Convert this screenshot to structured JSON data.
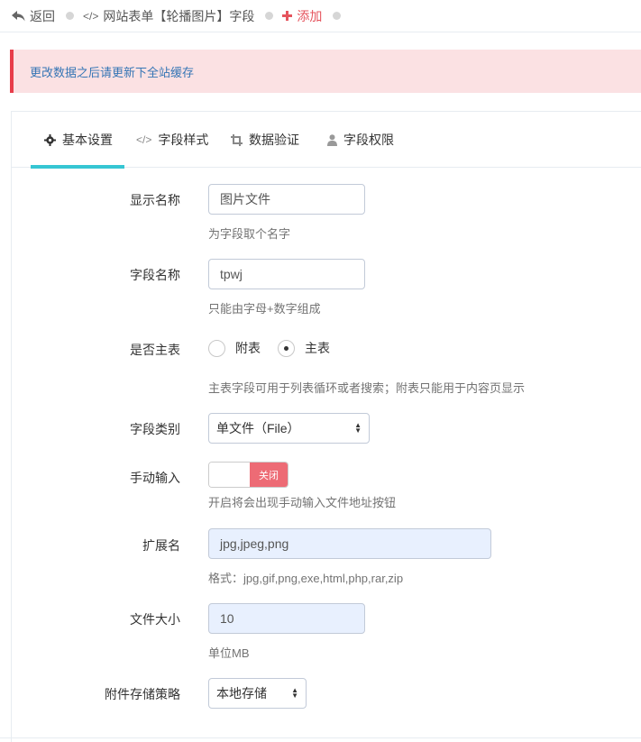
{
  "breadcrumb": {
    "back_label": "返回",
    "page_label": "网站表单【轮播图片】字段",
    "add_label": "添加"
  },
  "alert": {
    "text": "更改数据之后请更新下全站缓存"
  },
  "tabs": [
    {
      "label": "基本设置",
      "icon": "gear-icon"
    },
    {
      "label": "字段样式",
      "icon": "code-icon"
    },
    {
      "label": "数据验证",
      "icon": "crop-icon"
    },
    {
      "label": "字段权限",
      "icon": "user-icon"
    }
  ],
  "form": {
    "display_name": {
      "label": "显示名称",
      "value": "图片文件",
      "help": "为字段取个名字"
    },
    "field_name": {
      "label": "字段名称",
      "value": "tpwj",
      "help": "只能由字母+数字组成"
    },
    "main_table": {
      "label": "是否主表",
      "option_sub": "附表",
      "option_main": "主表",
      "selected": "主表",
      "help": "主表字段可用于列表循环或者搜索；附表只能用于内容页显示"
    },
    "field_type": {
      "label": "字段类别",
      "value": "单文件（File）"
    },
    "manual_input": {
      "label": "手动输入",
      "switch_text": "关闭",
      "help": "开启将会出现手动输入文件地址按钮"
    },
    "extension": {
      "label": "扩展名",
      "value": "jpg,jpeg,png",
      "help": "格式：jpg,gif,png,exe,html,php,rar,zip"
    },
    "file_size": {
      "label": "文件大小",
      "value": "10",
      "help": "单位MB"
    },
    "storage": {
      "label": "附件存储策略",
      "value": "本地存储"
    }
  },
  "colors": {
    "accent": "#36c6d3",
    "danger": "#e73d4a",
    "switch_off": "#ed6b75",
    "autofill": "#e8f0fe"
  }
}
